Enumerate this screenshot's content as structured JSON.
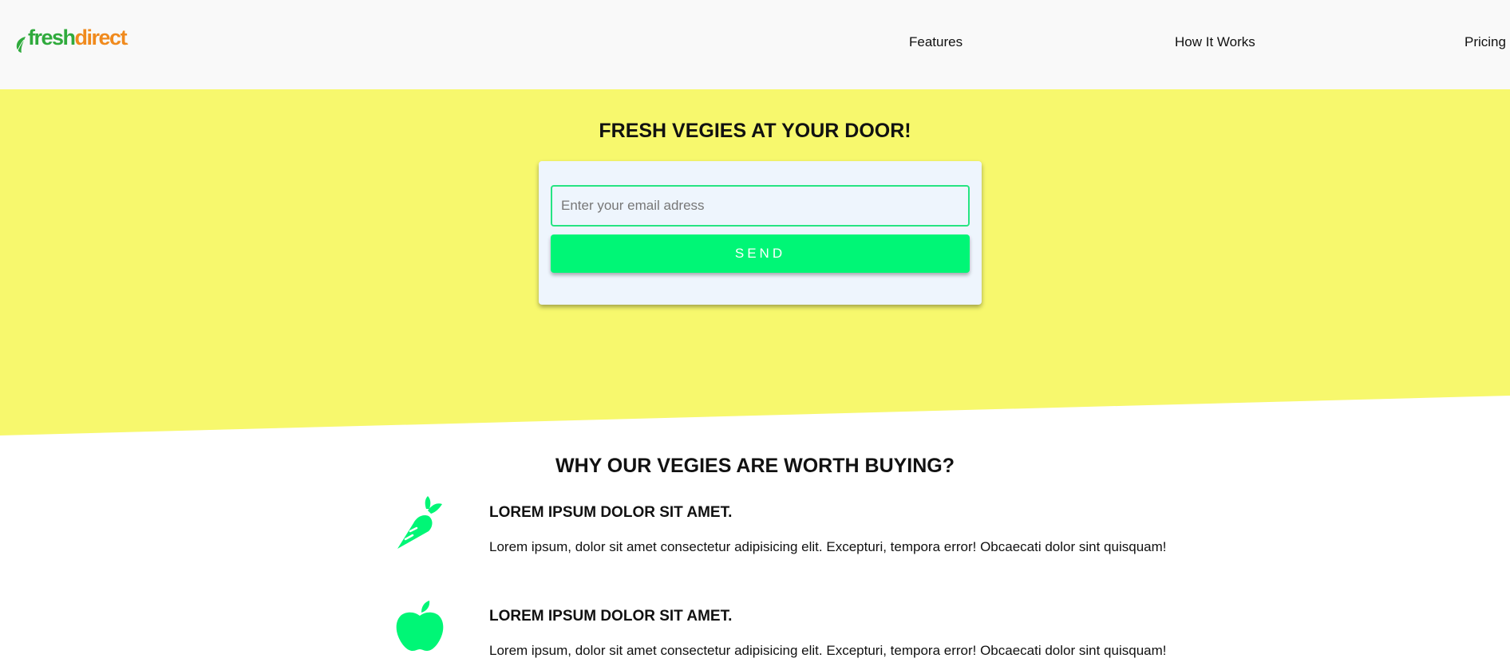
{
  "brand": {
    "logo_part1": "fresh",
    "logo_part2": "direct",
    "logo_dot": ".",
    "colors": {
      "green": "#2faa3c",
      "orange": "#f08a1d"
    }
  },
  "nav": {
    "items": [
      {
        "label": "Features"
      },
      {
        "label": "How It Works"
      },
      {
        "label": "Pricing"
      }
    ]
  },
  "hero": {
    "title": "FRESH VEGIES AT YOUR DOOR!",
    "background": "#f7f86d",
    "signup": {
      "email_placeholder": "Enter your email adress",
      "email_value": "",
      "send_label": "SEND",
      "button_color": "#00f676"
    }
  },
  "features": {
    "title": "WHY OUR VEGIES ARE WORTH BUYING?",
    "icon_color": "#00f676",
    "items": [
      {
        "icon": "carrot-icon",
        "heading": "LOREM IPSUM DOLOR SIT AMET.",
        "text": "Lorem ipsum, dolor sit amet consectetur adipisicing elit. Excepturi, tempora error! Obcaecati dolor sint quisquam!"
      },
      {
        "icon": "apple-icon",
        "heading": "LOREM IPSUM DOLOR SIT AMET.",
        "text": "Lorem ipsum, dolor sit amet consectetur adipisicing elit. Excepturi, tempora error! Obcaecati dolor sint quisquam!"
      }
    ]
  }
}
